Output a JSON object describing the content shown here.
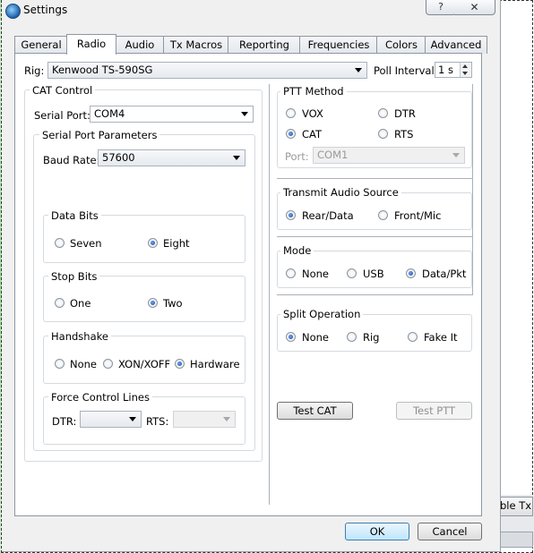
{
  "window": {
    "title": "Settings",
    "help_label": "?",
    "close_label": "✕",
    "icon": "app-globe-icon"
  },
  "tabs": [
    {
      "label": "General"
    },
    {
      "label": "Radio",
      "active": true
    },
    {
      "label": "Audio"
    },
    {
      "label": "Tx Macros"
    },
    {
      "label": "Reporting"
    },
    {
      "label": "Frequencies"
    },
    {
      "label": "Colors"
    },
    {
      "label": "Advanced"
    }
  ],
  "rig": {
    "label": "Rig:",
    "value": "Kenwood TS-590SG"
  },
  "poll": {
    "label": "Poll Interval:",
    "value": "1 s"
  },
  "cat": {
    "title": "CAT Control",
    "serial_port_label": "Serial Port:",
    "serial_port_value": "COM4",
    "params_title": "Serial Port Parameters",
    "baud_label": "Baud Rate:",
    "baud_value": "57600",
    "data_bits": {
      "title": "Data Bits",
      "options": [
        "Seven",
        "Eight"
      ],
      "selected": "Eight"
    },
    "stop_bits": {
      "title": "Stop Bits",
      "options": [
        "One",
        "Two"
      ],
      "selected": "Two"
    },
    "handshake": {
      "title": "Handshake",
      "options": [
        "None",
        "XON/XOFF",
        "Hardware"
      ],
      "selected": "Hardware"
    },
    "force": {
      "title": "Force Control Lines",
      "dtr_label": "DTR:",
      "dtr_value": "",
      "rts_label": "RTS:",
      "rts_value": ""
    }
  },
  "ptt": {
    "title": "PTT Method",
    "options": [
      "VOX",
      "DTR",
      "CAT",
      "RTS"
    ],
    "selected": "CAT",
    "port_label": "Port:",
    "port_value": "COM1"
  },
  "tx_audio": {
    "title": "Transmit Audio Source",
    "options": [
      "Rear/Data",
      "Front/Mic"
    ],
    "selected": "Rear/Data"
  },
  "mode": {
    "title": "Mode",
    "options": [
      "None",
      "USB",
      "Data/Pkt"
    ],
    "selected": "Data/Pkt"
  },
  "split": {
    "title": "Split Operation",
    "options": [
      "None",
      "Rig",
      "Fake It"
    ],
    "selected": "None"
  },
  "buttons": {
    "test_cat": "Test CAT",
    "test_ptt": "Test PTT",
    "ok": "OK",
    "cancel": "Cancel"
  },
  "background": {
    "partial_button_text": "ble Tx"
  },
  "colors": {
    "accent": "#3c7fb1",
    "panel": "#ffffff",
    "dialog": "#f0f0f0"
  }
}
